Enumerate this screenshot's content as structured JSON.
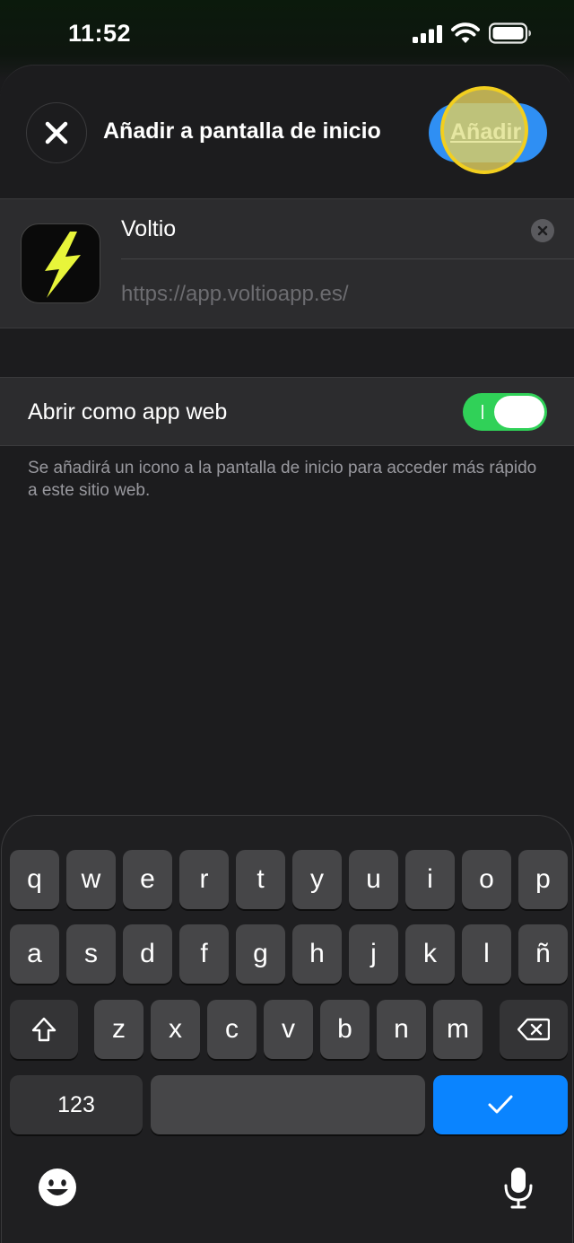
{
  "status": {
    "time": "11:52",
    "icons": [
      "signal-icon",
      "wifi-icon",
      "battery-icon"
    ]
  },
  "header": {
    "close_icon": "close-icon",
    "title": "Añadir a pantalla de inicio",
    "add_label": "Añadir"
  },
  "app": {
    "icon": "lightning-bolt-icon",
    "name": "Voltio",
    "url": "https://app.voltioapp.es/"
  },
  "options": {
    "web_app_label": "Abrir como app web",
    "web_app_enabled": true,
    "footnote": "Se añadirá un icono a la pantalla de inicio para acceder más rápido a este sitio web."
  },
  "keyboard": {
    "row1": [
      "q",
      "w",
      "e",
      "r",
      "t",
      "y",
      "u",
      "i",
      "o",
      "p"
    ],
    "row2": [
      "a",
      "s",
      "d",
      "f",
      "g",
      "h",
      "j",
      "k",
      "l",
      "ñ"
    ],
    "row3": [
      "z",
      "x",
      "c",
      "v",
      "b",
      "n",
      "m"
    ],
    "numbers_label": "123",
    "done_icon": "checkmark-icon",
    "emoji_icon": "emoji-icon",
    "mic_icon": "microphone-icon"
  },
  "colors": {
    "accent": "#0a84ff",
    "toggle_on": "#30d158",
    "bolt": "#e8f53a",
    "tap_highlight": "#f2cf1f"
  }
}
